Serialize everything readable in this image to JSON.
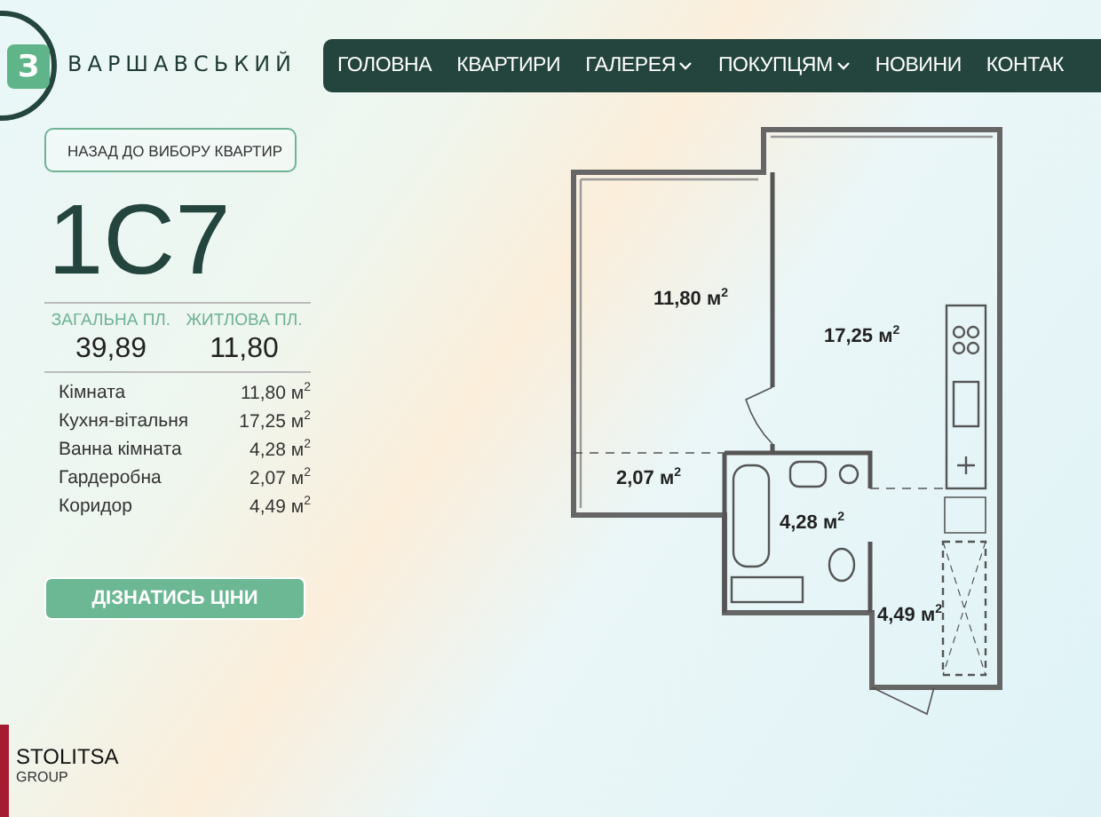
{
  "brand": {
    "logo_letter": "З",
    "name": "ВАРШАВСЬКИЙ"
  },
  "nav": [
    {
      "label": "ГОЛОВНА",
      "has_dropdown": false
    },
    {
      "label": "КВАРТИРИ",
      "has_dropdown": false
    },
    {
      "label": "ГАЛЕРЕЯ",
      "has_dropdown": true
    },
    {
      "label": "ПОКУПЦЯМ",
      "has_dropdown": true
    },
    {
      "label": "НОВИНИ",
      "has_dropdown": false
    },
    {
      "label": "КОНТАК",
      "has_dropdown": false
    }
  ],
  "back_button": "НАЗАД ДО ВИБОРУ КВАРТИР",
  "apartment": "1С7",
  "areas": [
    {
      "label": "ЗАГАЛЬНА ПЛ.",
      "value": "39,89"
    },
    {
      "label": "ЖИТЛОВА ПЛ.",
      "value": "11,80"
    }
  ],
  "rooms": [
    {
      "name": "Кімната",
      "area": "11,80 м$^{2}$"
    },
    {
      "name": "Кухня-вітальня",
      "area": "17,25 м$^{2}$"
    },
    {
      "name": "Ванна кімната",
      "area": "4,28 м$^{2}$"
    },
    {
      "name": "Гардеробна",
      "area": "2,07 м$^{2}$"
    },
    {
      "name": "Коридор",
      "area": "4,49 м$^{2}$"
    }
  ],
  "price_button": "ДІЗНАТИСЬ ЦІНИ",
  "developer": {
    "name": "STOLITSA",
    "sub": "GROUP"
  },
  "plan_labels": [
    "11,80 м$^{2}$",
    "17,25 м$^{2}$",
    "2,07 м$^{2}$",
    "4,28 м$^{2}$",
    "4,49 м$^{2}$"
  ]
}
